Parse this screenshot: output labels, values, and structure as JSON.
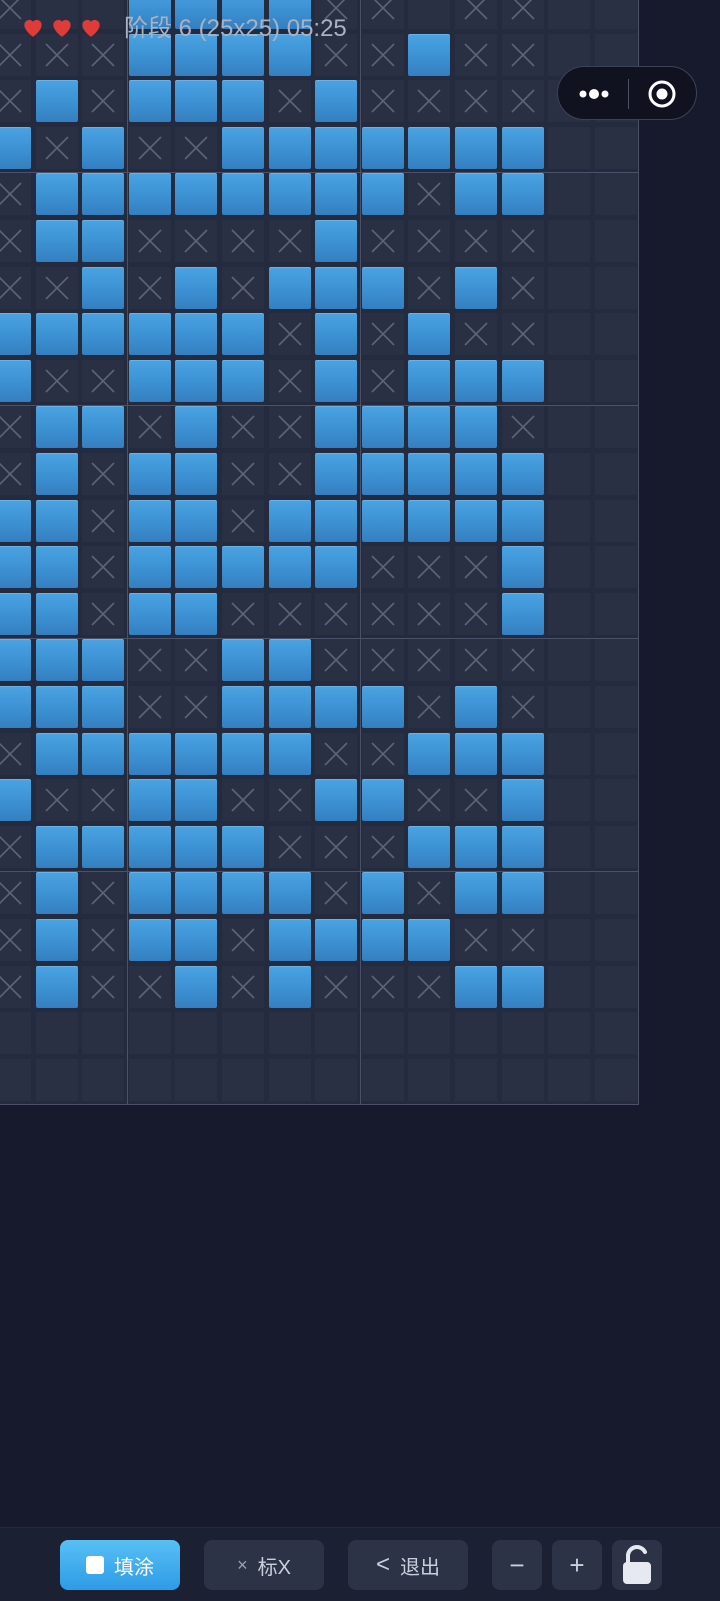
{
  "hud": {
    "lives": 3,
    "stage_text": "阶段 6 (25x25)  05:25"
  },
  "capsule": {
    "more_icon": "more-dots-icon",
    "target_icon": "target-icon"
  },
  "board": {
    "grid_size": "25x25",
    "visible_cols": 14,
    "visible_rows": 24,
    "legend": {
      "F": "filled",
      "X": "marked-x",
      ".": "empty"
    },
    "rows": [
      "X..FFFFXX.XX..",
      "XXXFFFFXXFXX..",
      "XFXFFFXFXXXX..",
      "FXFXXFFFFFFF..",
      "XFFFFFFFFXFF..",
      "XFFXXXXFXXXX..",
      "XXFXFXFFFXFX..",
      "FFFFFFXFXFXX..",
      "FXXFFFXFXFFF..",
      "XFFXFXXFFFFX..",
      "XFXFFXXFFFFF..",
      "FFXFFXFFFFFF..",
      "FFXFFFFFXXXF..",
      "FFXFFXXXXXXF..",
      "FFFXXFFXXXXX..",
      "FFFXXFFFFXFX..",
      "XFFFFFFXXFFF..",
      "FXXFFXXFFXXF..",
      "XFFFFFXXXFFF..",
      "XFXFFFFXFXFF..",
      "XFXFFXFFFFXX..",
      "XFXXFXFXXXFF..",
      "..............",
      ".............."
    ]
  },
  "toolbar": {
    "fill_label": "填涂",
    "mark_icon": "×",
    "mark_label": "标X",
    "exit_icon": "<",
    "exit_label": "退出",
    "zoom_out_label": "−",
    "zoom_in_label": "+",
    "lock_icon": "unlocked-padlock-icon"
  }
}
